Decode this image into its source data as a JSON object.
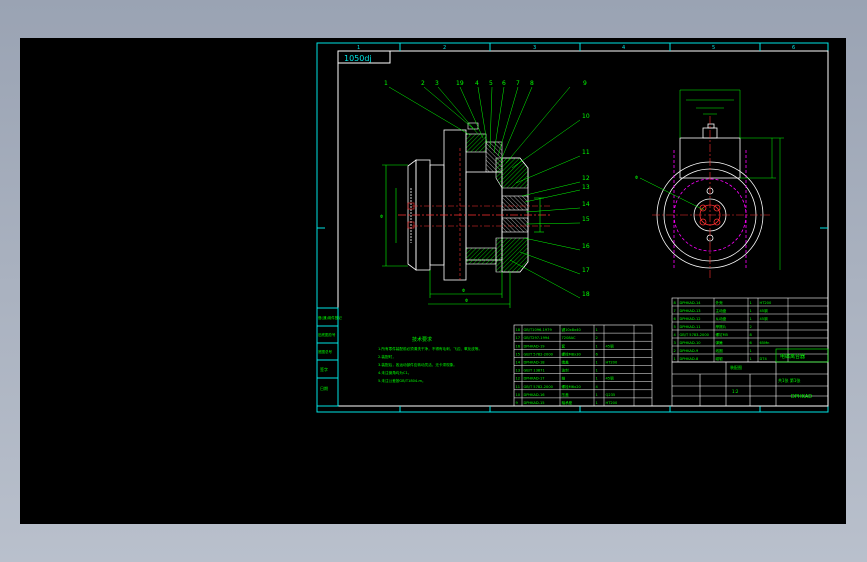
{
  "drawing": {
    "drawing_number": "1050dj",
    "zone_numbers": [
      "1",
      "2",
      "3",
      "4",
      "5",
      "6"
    ],
    "balloons": [
      "1",
      "2",
      "3",
      "19",
      "4",
      "5",
      "6",
      "7",
      "8",
      "9",
      "10",
      "11",
      "12",
      "13",
      "14",
      "15",
      "16",
      "17",
      "18"
    ],
    "tech_req": {
      "title": "技术要求",
      "lines": [
        "1.所有零件装配前必须清洗干净，不得有毛刺、飞边、氧化皮等。",
        "2.装配时，",
        "3.装配后，各运动部件应转动灵活，无卡滞现象。",
        "4.未注倒角均为C1。",
        "5.未注公差按GB/T1804-m。"
      ]
    },
    "bom_left": [
      {
        "no": "18",
        "code": "GB/T1096-1979",
        "name": "键10x8x40",
        "qty": "1",
        "mat": "",
        "note": ""
      },
      {
        "no": "17",
        "code": "GB/T297-1994",
        "name": "7208AC",
        "qty": "2",
        "mat": "",
        "note": ""
      },
      {
        "no": "16",
        "code": "DPHKAD-19",
        "name": "套",
        "qty": "1",
        "mat": "45钢",
        "note": ""
      },
      {
        "no": "15",
        "code": "GB/T 5782-2000",
        "name": "螺栓M8x30",
        "qty": "6",
        "mat": "",
        "note": ""
      },
      {
        "no": "14",
        "code": "DPHKAD-18",
        "name": "端盖",
        "qty": "1",
        "mat": "HT200",
        "note": ""
      },
      {
        "no": "13",
        "code": "GB/T 13871",
        "name": "油封",
        "qty": "1",
        "mat": "",
        "note": ""
      },
      {
        "no": "12",
        "code": "DPHKAD-17",
        "name": "轴",
        "qty": "1",
        "mat": "45钢",
        "note": ""
      },
      {
        "no": "11",
        "code": "GB/T 5782-2000",
        "name": "螺栓M6x20",
        "qty": "4",
        "mat": "",
        "note": ""
      },
      {
        "no": "10",
        "code": "DPHKAD-16",
        "name": "压盖",
        "qty": "1",
        "mat": "Q235",
        "note": ""
      },
      {
        "no": "9",
        "code": "DPHKAD-15",
        "name": "轴承座",
        "qty": "1",
        "mat": "HT200",
        "note": ""
      }
    ],
    "bom_right": [
      {
        "no": "8",
        "code": "DPHKAD-14",
        "name": "外壳",
        "qty": "1",
        "mat": "HT200"
      },
      {
        "no": "7",
        "code": "DPHKAD-13",
        "name": "主动盘",
        "qty": "1",
        "mat": "45钢"
      },
      {
        "no": "6",
        "code": "DPHKAD-12",
        "name": "从动盘",
        "qty": "1",
        "mat": "45钢"
      },
      {
        "no": "5",
        "code": "DPHKAD-11",
        "name": "摩擦片",
        "qty": "2",
        "mat": ""
      },
      {
        "no": "4",
        "code": "GB/T 5783-2000",
        "name": "螺钉M5",
        "qty": "8",
        "mat": ""
      },
      {
        "no": "3",
        "code": "DPHKAD-10",
        "name": "弹簧",
        "qty": "6",
        "mat": "65Mn"
      },
      {
        "no": "2",
        "code": "DPHKAD-9",
        "name": "线圈",
        "qty": "1",
        "mat": ""
      },
      {
        "no": "1",
        "code": "DPHKAD-8",
        "name": "磁轭",
        "qty": "1",
        "mat": "DT4"
      }
    ],
    "title_block": {
      "assembly_name": "电磁离合器",
      "drawing_code": "DPHKAD",
      "sheet": "共1张 第1张",
      "scale": "1:2",
      "material": "装配图"
    },
    "side_strip": [
      "借(通)用件登记",
      "旧底图总号",
      "底图总号",
      "签字",
      "日期"
    ]
  }
}
